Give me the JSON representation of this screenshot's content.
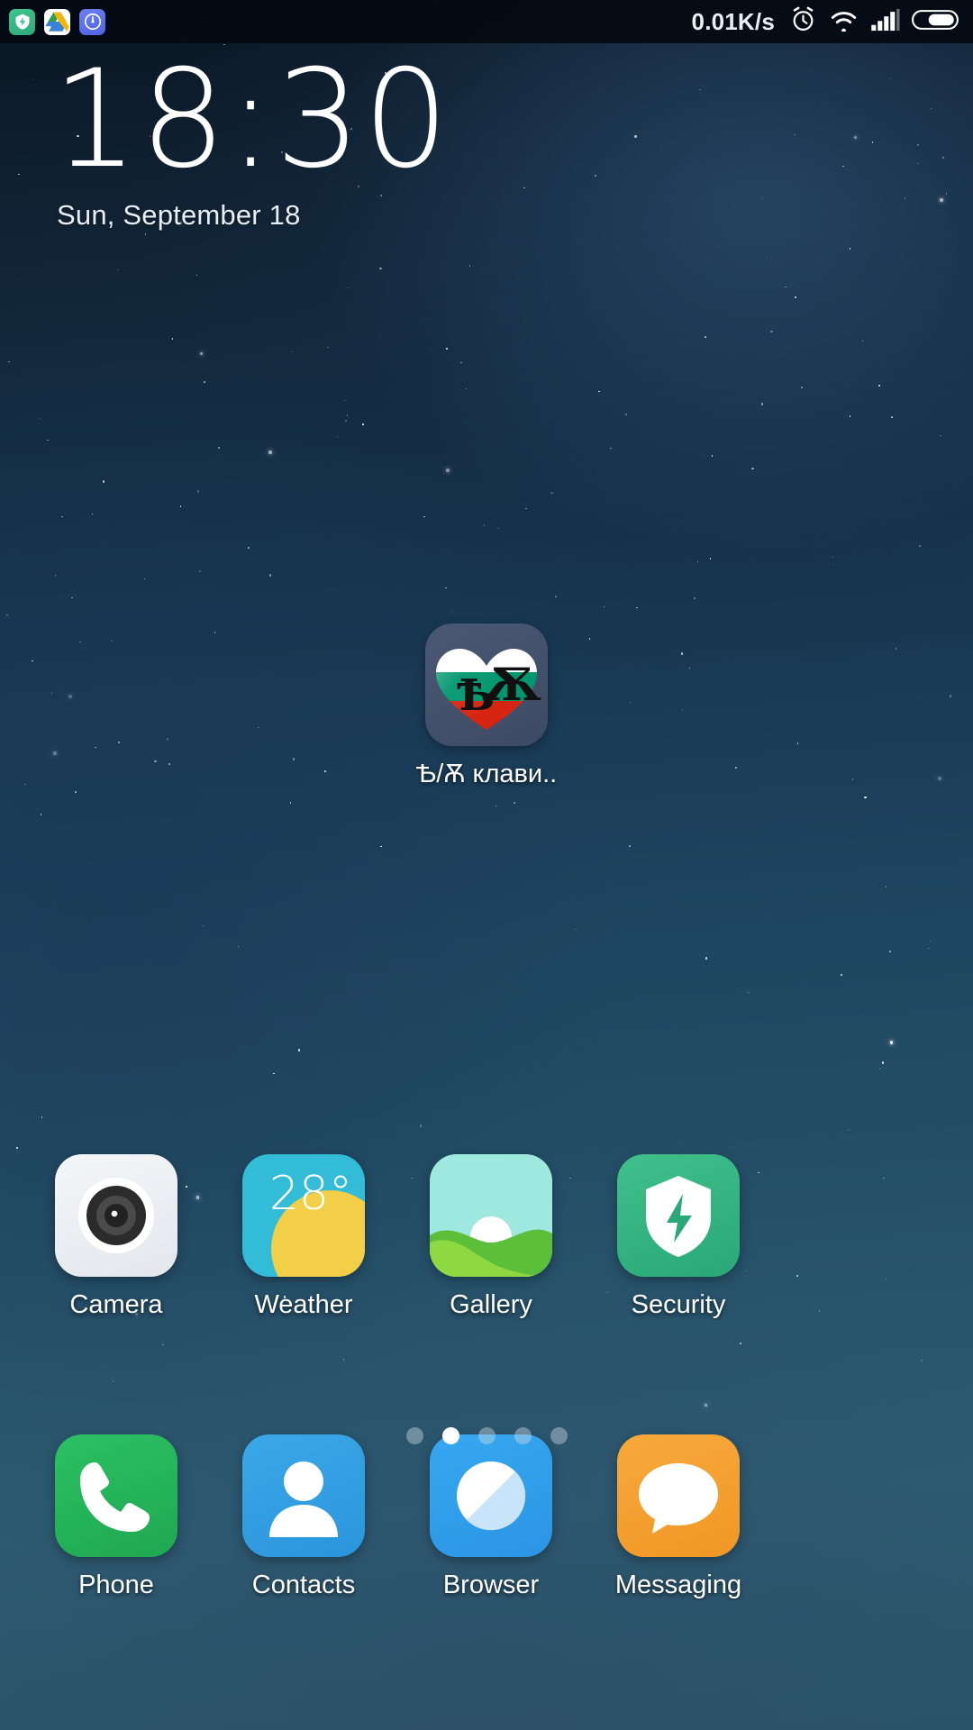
{
  "status_bar": {
    "network_speed": "0.01K/s",
    "notification_icons": [
      {
        "name": "security-app-icon",
        "label": "Security"
      },
      {
        "name": "google-drive-icon",
        "label": "Drive"
      },
      {
        "name": "speed-test-icon",
        "label": "Speed"
      }
    ],
    "system_icons": [
      {
        "name": "alarm-clock-icon",
        "label": "Alarm set"
      },
      {
        "name": "wifi-icon",
        "label": "Wi-Fi connected"
      },
      {
        "name": "cellular-signal-icon",
        "label": "Signal 4 bars"
      },
      {
        "name": "battery-icon",
        "label": "Battery",
        "level_percent": 62
      }
    ]
  },
  "clock_widget": {
    "time": "18:30",
    "date": "Sun, September 18"
  },
  "home_apps": [
    {
      "name": "app-bulgarian-keyboard",
      "label": "Ѣ/Ѫ клави..",
      "icon": "bulgarian-flag-heart-icon"
    }
  ],
  "app_row": [
    {
      "name": "app-camera",
      "label": "Camera",
      "icon": "camera-lens-icon"
    },
    {
      "name": "app-weather",
      "label": "Weather",
      "icon": "weather-sun-icon",
      "temperature": "28°"
    },
    {
      "name": "app-gallery",
      "label": "Gallery",
      "icon": "gallery-landscape-icon"
    },
    {
      "name": "app-security",
      "label": "Security",
      "icon": "shield-bolt-icon"
    }
  ],
  "dock_apps": [
    {
      "name": "app-phone",
      "label": "Phone",
      "icon": "phone-handset-icon"
    },
    {
      "name": "app-contacts",
      "label": "Contacts",
      "icon": "person-silhouette-icon"
    },
    {
      "name": "app-browser",
      "label": "Browser",
      "icon": "browser-compass-icon"
    },
    {
      "name": "app-messaging",
      "label": "Messaging",
      "icon": "speech-bubble-icon"
    }
  ],
  "page_indicator": {
    "total_pages": 5,
    "current_page": 2
  },
  "colors": {
    "accent_green": "#2aa878",
    "accent_cyan": "#33bcd8",
    "accent_blue": "#2b95e4",
    "accent_orange": "#f09726",
    "flag_white": "#ffffff",
    "flag_green": "#00966e",
    "flag_red": "#d62612"
  }
}
